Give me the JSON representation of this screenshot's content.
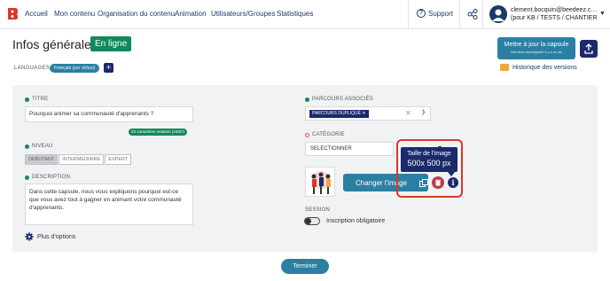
{
  "nav": {
    "items": [
      "Accueil",
      "Mon contenu",
      "Organisation du contenu",
      "Animation",
      "Utilisateurs/Groupes",
      "Statistiques"
    ],
    "support": "Support",
    "user_line1": "clement.bocquin@beedeez.c…",
    "user_line2": "(pour KB / TESTS / CHANTIER"
  },
  "header": {
    "title": "Infos générales",
    "status_badge": "En ligne",
    "languages_label": "LANGUAGES",
    "language_chip": "Français",
    "language_default": "(par défaut)",
    "add_language": "+",
    "update_button": "Mettre à jour la capsule",
    "update_sub": "Dernière sauvegarde il y a un an",
    "history_link": "Historique des versions"
  },
  "form": {
    "title_label": "TITRE",
    "title_value": "Pourquoi animer sa communauté d'apprenants ?",
    "title_counter": "23 caractères restants (44/67)",
    "level_label": "NIVEAU",
    "levels": [
      "DEBUTANT",
      "INTERMEDIAIRE",
      "EXPERT"
    ],
    "selected_level": "DEBUTANT",
    "description_label": "DESCRIPTION",
    "description_value": "Dans cette capsule, nous vous expliquons pourquoi est-ce que vous avez tout à gagner en animant votre communauté d'apprenants.",
    "more_options": "Plus d'options",
    "parcours_label": "PARCOURS ASSOCIÉS",
    "parcours_chip": "PARCOURS DUPLIQUÉ",
    "categorie_label": "CATÉGORIE",
    "categorie_placeholder": "SELECTIONNER",
    "change_image": "Changer l'image",
    "tooltip_title": "Taille de l'image",
    "tooltip_size": "500x 500 px",
    "session_label": "SESSION",
    "session_toggle_label": "Inscription obligatoire",
    "session_enabled": false
  },
  "footer": {
    "finish_button": "Terminer"
  },
  "colors": {
    "primary": "#2b7fa3",
    "navy": "#1b2a6b",
    "green": "#0f8a5a",
    "highlight": "#d8382a",
    "danger": "#c0394a"
  }
}
